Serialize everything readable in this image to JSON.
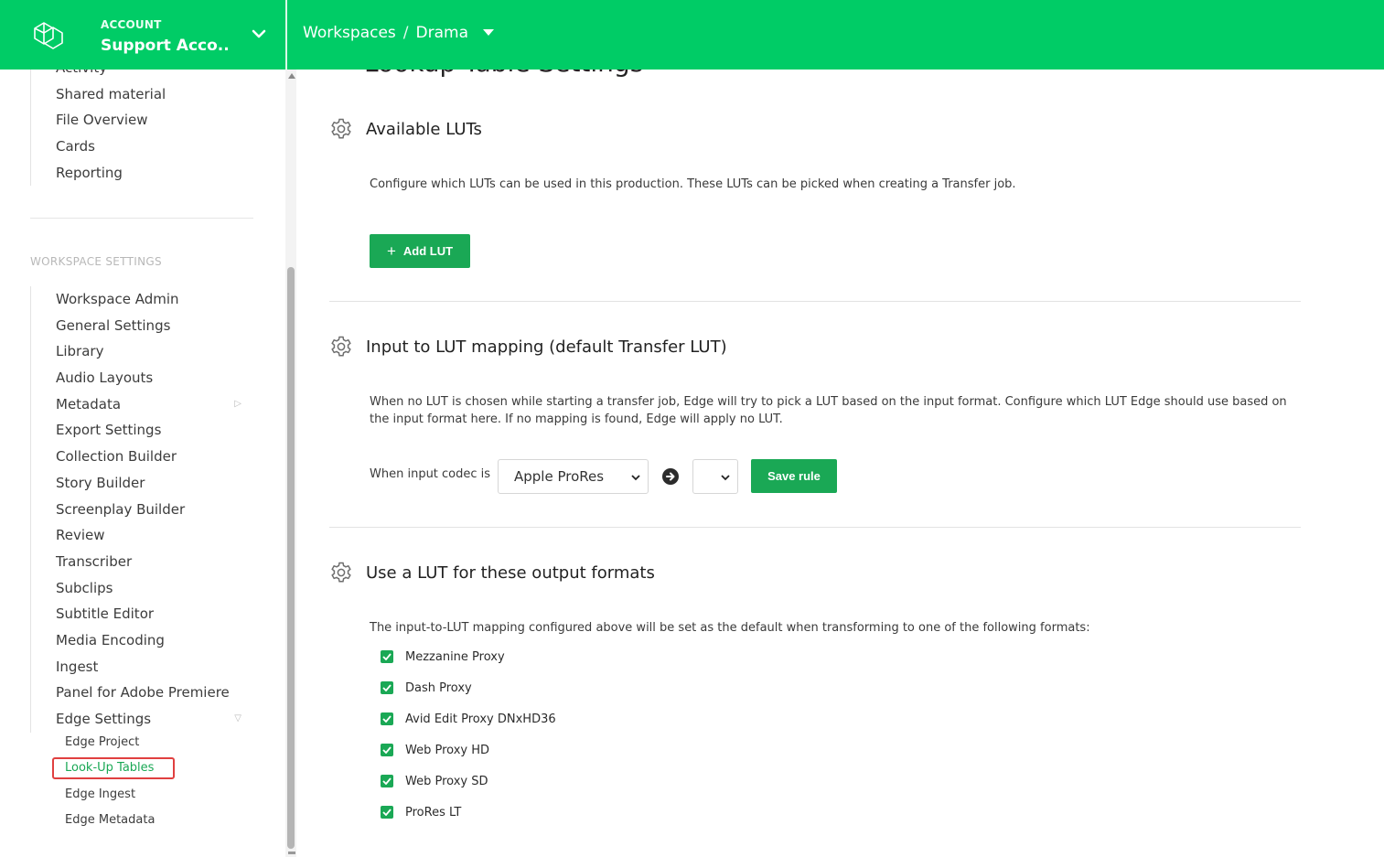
{
  "colors": {
    "brand": "#00cc66",
    "accent": "#1aa855",
    "highlight_box": "#e04040"
  },
  "account": {
    "label": "ACCOUNT",
    "name": "Support Acco..."
  },
  "breadcrumb": {
    "root": "Workspaces",
    "separator": "/",
    "current": "Drama"
  },
  "sidebar": {
    "top_items": [
      "Activity",
      "Shared material",
      "File Overview",
      "Cards",
      "Reporting"
    ],
    "section_title": "WORKSPACE SETTINGS",
    "settings_items": [
      "Workspace Admin",
      "General Settings",
      "Library",
      "Audio Layouts",
      "Metadata",
      "Export Settings",
      "Collection Builder",
      "Story Builder",
      "Screenplay Builder",
      "Review",
      "Transcriber",
      "Subclips",
      "Subtitle Editor",
      "Media Encoding",
      "Ingest",
      "Panel for Adobe Premiere",
      "Edge Settings"
    ],
    "edge_sub_items": [
      "Edge Project",
      "Look-Up Tables",
      "Edge Ingest",
      "Edge Metadata"
    ],
    "active_sub_item": "Look-Up Tables"
  },
  "main": {
    "page_title_partial": "Lookup Table Settings",
    "available_luts": {
      "title": "Available LUTs",
      "description": "Configure which LUTs can be used in this production. These LUTs can be picked when creating a Transfer job.",
      "add_button": "Add LUT"
    },
    "mapping": {
      "title": "Input to LUT mapping (default Transfer LUT)",
      "description": "When no LUT is chosen while starting a transfer job, Edge will try to pick a LUT based on the input format. Configure which LUT Edge should use based on the input format here. If no mapping is found, Edge will apply no LUT.",
      "rule_label": "When input codec is",
      "codec_value": "Apple ProRes",
      "lut_value": "",
      "save_button": "Save rule"
    },
    "output_formats": {
      "title": "Use a LUT for these output formats",
      "description": "The input-to-LUT mapping configured above will be set as the default when transforming to one of the following formats:",
      "formats": [
        {
          "label": "Mezzanine Proxy",
          "checked": true
        },
        {
          "label": "Dash Proxy",
          "checked": true
        },
        {
          "label": "Avid Edit Proxy DNxHD36",
          "checked": true
        },
        {
          "label": "Web Proxy HD",
          "checked": true
        },
        {
          "label": "Web Proxy SD",
          "checked": true
        },
        {
          "label": "ProRes LT",
          "checked": true
        }
      ]
    }
  }
}
